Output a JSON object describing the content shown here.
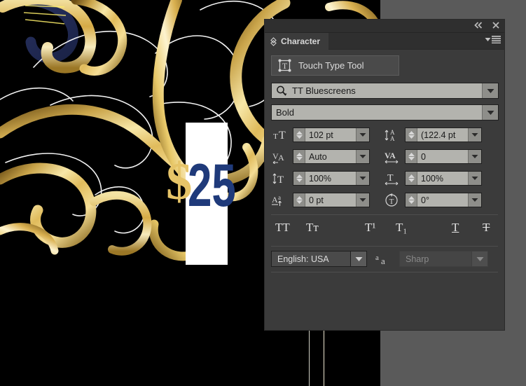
{
  "canvas": {
    "background_color": "#000000",
    "workspace_color": "#5a5a5a",
    "artwork_name": "gold-filigree-swirls",
    "price_dollar": "$",
    "price_number": "25",
    "price_dollar_color": "#e6c468",
    "price_number_color": "#1f3a7a",
    "price_box_color": "#ffffff"
  },
  "panel": {
    "title": "Character",
    "tab_label": "Character",
    "titlebar": {
      "collapse_icon": "double-chevron-left-icon",
      "close_icon": "close-icon",
      "menu_icon": "panel-menu-icon"
    },
    "touch_type_tool": {
      "label": "Touch Type Tool",
      "icon": "touch-type-tool-icon"
    },
    "font_family": {
      "value": "TT Bluescreens",
      "icon": "font-search-icon"
    },
    "font_style": {
      "value": "Bold"
    },
    "fields": [
      {
        "name": "font-size",
        "icon": "font-size-icon",
        "value": "102 pt"
      },
      {
        "name": "leading",
        "icon": "leading-icon",
        "value": "(122.4 pt"
      },
      {
        "name": "kerning",
        "icon": "kerning-icon",
        "value": "Auto"
      },
      {
        "name": "tracking",
        "icon": "tracking-icon",
        "value": "0"
      },
      {
        "name": "vertical-scale",
        "icon": "vertical-scale-icon",
        "value": "100%"
      },
      {
        "name": "horizontal-scale",
        "icon": "horizontal-scale-icon",
        "value": "100%"
      },
      {
        "name": "baseline-shift",
        "icon": "baseline-shift-icon",
        "value": "0 pt"
      },
      {
        "name": "character-rotation",
        "icon": "character-rotation-icon",
        "value": "0°"
      }
    ],
    "style_buttons": [
      {
        "name": "all-caps",
        "label": "TT"
      },
      {
        "name": "small-caps",
        "label": "Tᴛ"
      },
      {
        "name": "superscript",
        "label": "T¹"
      },
      {
        "name": "subscript",
        "label": "T₁"
      },
      {
        "name": "underline",
        "label": "T"
      },
      {
        "name": "strikethrough",
        "label": "T"
      }
    ],
    "language": {
      "value": "English: USA"
    },
    "anti_aliasing": {
      "icon": "anti-aliasing-icon",
      "value": "Sharp",
      "disabled": true
    }
  }
}
